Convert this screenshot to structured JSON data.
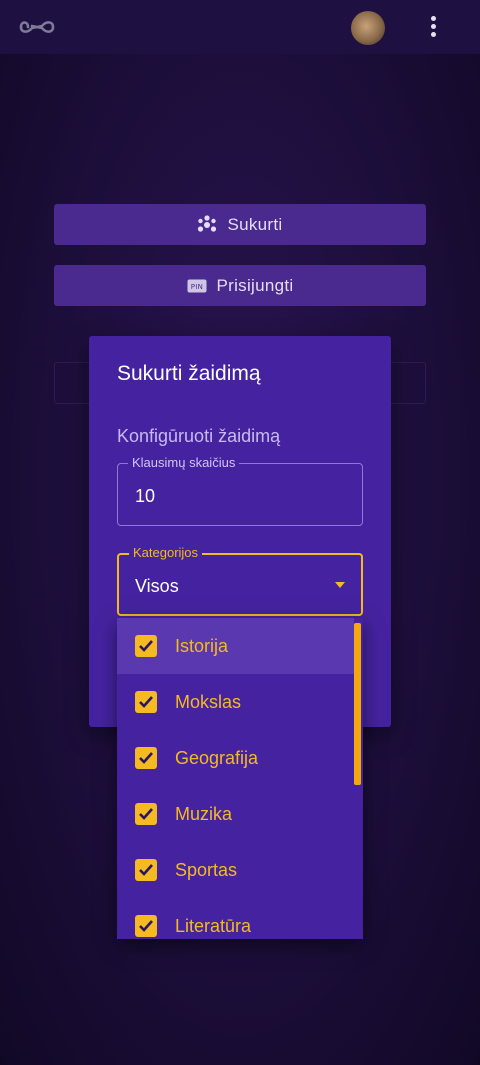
{
  "topbar": {
    "logo_icon": "infinity-icon",
    "avatar_icon": "cat-avatar",
    "menu_icon": "kebab-menu-icon"
  },
  "actions": {
    "create_label": "Sukurti",
    "create_icon": "atom-icon",
    "join_label": "Prisijungti",
    "join_icon": "pin-icon",
    "join_icon_text": "PIN"
  },
  "dialog": {
    "title": "Sukurti žaidimą",
    "subtitle": "Konfigūruoti žaidimą",
    "questions_field": {
      "label": "Klausimų skaičius",
      "value": "10"
    },
    "categories_field": {
      "label": "Kategorijos",
      "value": "Visos"
    }
  },
  "categories_menu": {
    "items": [
      {
        "label": "Istorija",
        "checked": true
      },
      {
        "label": "Mokslas",
        "checked": true
      },
      {
        "label": "Geografija",
        "checked": true
      },
      {
        "label": "Muzika",
        "checked": true
      },
      {
        "label": "Sportas",
        "checked": true
      },
      {
        "label": "Literatūra",
        "checked": true
      }
    ]
  },
  "colors": {
    "accent": "#f5b921",
    "dialog": "#4523a0",
    "button": "#4a2a8e",
    "background": "#1c0e3a"
  }
}
